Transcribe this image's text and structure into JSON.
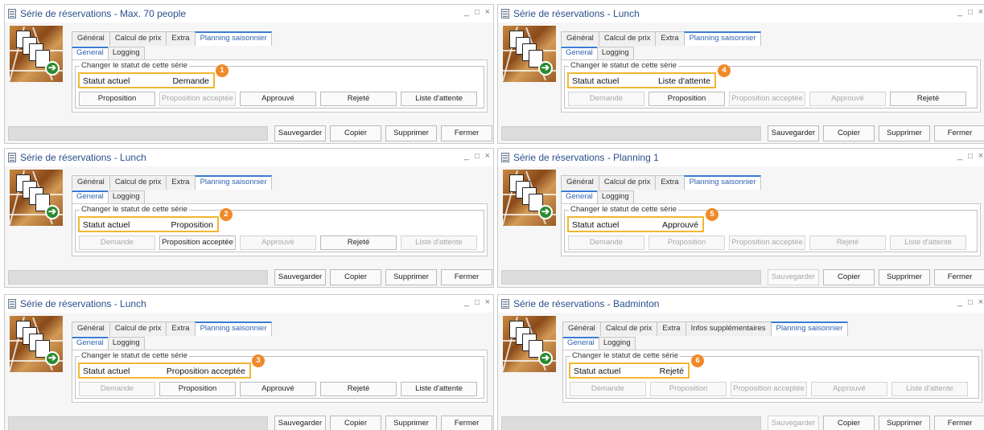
{
  "windows": [
    {
      "title": "Série de réservations - Max. 70 people",
      "tabs": [
        {
          "label": "Général",
          "active": false
        },
        {
          "label": "Calcul de prix",
          "active": false
        },
        {
          "label": "Extra",
          "active": false
        },
        {
          "label": "Planning saisonnier",
          "active": true
        }
      ],
      "subtabs": [
        {
          "label": "General",
          "active": true
        },
        {
          "label": "Logging",
          "active": false
        }
      ],
      "group_label": "Changer le statut de cette série",
      "status_label": "Statut actuel",
      "status_value": "Demande",
      "marker": "1",
      "status_buttons": [
        {
          "label": "Proposition",
          "enabled": true
        },
        {
          "label": "Proposition acceptée",
          "enabled": false
        },
        {
          "label": "Approuvé",
          "enabled": true
        },
        {
          "label": "Rejeté",
          "enabled": true
        },
        {
          "label": "Liste d'attente",
          "enabled": true
        }
      ],
      "action_buttons": [
        {
          "label": "Sauvegarder",
          "enabled": true
        },
        {
          "label": "Copier",
          "enabled": true
        },
        {
          "label": "Supprimer",
          "enabled": true
        },
        {
          "label": "Fermer",
          "enabled": true
        }
      ],
      "window_controls": [
        "_",
        "□",
        "×"
      ]
    },
    {
      "title": "Série de réservations - Lunch",
      "tabs": [
        {
          "label": "Général",
          "active": false
        },
        {
          "label": "Calcul de prix",
          "active": false
        },
        {
          "label": "Extra",
          "active": false
        },
        {
          "label": "Planning saisonnier",
          "active": true
        }
      ],
      "subtabs": [
        {
          "label": "General",
          "active": true
        },
        {
          "label": "Logging",
          "active": false
        }
      ],
      "group_label": "Changer le statut de cette série",
      "status_label": "Statut actuel",
      "status_value": "Liste d'attente",
      "marker": "4",
      "status_buttons": [
        {
          "label": "Demande",
          "enabled": false
        },
        {
          "label": "Proposition",
          "enabled": true
        },
        {
          "label": "Proposition acceptée",
          "enabled": false
        },
        {
          "label": "Approuvé",
          "enabled": false
        },
        {
          "label": "Rejeté",
          "enabled": true
        }
      ],
      "action_buttons": [
        {
          "label": "Sauvegarder",
          "enabled": true
        },
        {
          "label": "Copier",
          "enabled": true
        },
        {
          "label": "Supprimer",
          "enabled": true
        },
        {
          "label": "Fermer",
          "enabled": true
        }
      ],
      "window_controls": [
        "_",
        "□",
        "×"
      ]
    },
    {
      "title": "Série de réservations - Lunch",
      "tabs": [
        {
          "label": "Général",
          "active": false
        },
        {
          "label": "Calcul de prix",
          "active": false
        },
        {
          "label": "Extra",
          "active": false
        },
        {
          "label": "Planning saisonnier",
          "active": true
        }
      ],
      "subtabs": [
        {
          "label": "General",
          "active": true
        },
        {
          "label": "Logging",
          "active": false
        }
      ],
      "group_label": "Changer le statut de cette série",
      "status_label": "Statut actuel",
      "status_value": "Proposition",
      "marker": "2",
      "status_buttons": [
        {
          "label": "Demande",
          "enabled": false
        },
        {
          "label": "Proposition acceptée",
          "enabled": true
        },
        {
          "label": "Approuvé",
          "enabled": false
        },
        {
          "label": "Rejeté",
          "enabled": true
        },
        {
          "label": "Liste d'attente",
          "enabled": false
        }
      ],
      "action_buttons": [
        {
          "label": "Sauvegarder",
          "enabled": true
        },
        {
          "label": "Copier",
          "enabled": true
        },
        {
          "label": "Supprimer",
          "enabled": true
        },
        {
          "label": "Fermer",
          "enabled": true
        }
      ],
      "window_controls": [
        "_",
        "□",
        "×"
      ]
    },
    {
      "title": "Série de réservations - Planning 1",
      "tabs": [
        {
          "label": "Général",
          "active": false
        },
        {
          "label": "Calcul de prix",
          "active": false
        },
        {
          "label": "Extra",
          "active": false
        },
        {
          "label": "Planning saisonnier",
          "active": true
        }
      ],
      "subtabs": [
        {
          "label": "General",
          "active": true
        },
        {
          "label": "Logging",
          "active": false
        }
      ],
      "group_label": "Changer le statut de cette série",
      "status_label": "Statut actuel",
      "status_value": "Approuvé",
      "marker": "5",
      "status_buttons": [
        {
          "label": "Demande",
          "enabled": false
        },
        {
          "label": "Proposition",
          "enabled": false
        },
        {
          "label": "Proposition acceptée",
          "enabled": false
        },
        {
          "label": "Rejeté",
          "enabled": false
        },
        {
          "label": "Liste d'attente",
          "enabled": false
        }
      ],
      "action_buttons": [
        {
          "label": "Sauvegarder",
          "enabled": false
        },
        {
          "label": "Copier",
          "enabled": true
        },
        {
          "label": "Supprimer",
          "enabled": true
        },
        {
          "label": "Fermer",
          "enabled": true
        }
      ],
      "window_controls": [
        "_",
        "□",
        "×"
      ]
    },
    {
      "title": "Série de réservations - Lunch",
      "tabs": [
        {
          "label": "Général",
          "active": false
        },
        {
          "label": "Calcul de prix",
          "active": false
        },
        {
          "label": "Extra",
          "active": false
        },
        {
          "label": "Planning saisonnier",
          "active": true
        }
      ],
      "subtabs": [
        {
          "label": "General",
          "active": true
        },
        {
          "label": "Logging",
          "active": false
        }
      ],
      "group_label": "Changer le statut de cette série",
      "status_label": "Statut actuel",
      "status_value": "Proposition acceptée",
      "marker": "3",
      "status_buttons": [
        {
          "label": "Demande",
          "enabled": false
        },
        {
          "label": "Proposition",
          "enabled": true
        },
        {
          "label": "Approuvé",
          "enabled": true
        },
        {
          "label": "Rejeté",
          "enabled": true
        },
        {
          "label": "Liste d'attente",
          "enabled": true
        }
      ],
      "action_buttons": [
        {
          "label": "Sauvegarder",
          "enabled": true
        },
        {
          "label": "Copier",
          "enabled": true
        },
        {
          "label": "Supprimer",
          "enabled": true
        },
        {
          "label": "Fermer",
          "enabled": true
        }
      ],
      "window_controls": [
        "_",
        "□",
        "×"
      ]
    },
    {
      "title": "Série de réservations - Badminton",
      "tabs": [
        {
          "label": "Général",
          "active": false
        },
        {
          "label": "Calcul de prix",
          "active": false
        },
        {
          "label": "Extra",
          "active": false
        },
        {
          "label": "Infos supplémentaires",
          "active": false
        },
        {
          "label": "Planning saisonnier",
          "active": true
        }
      ],
      "subtabs": [
        {
          "label": "General",
          "active": true
        },
        {
          "label": "Logging",
          "active": false
        }
      ],
      "group_label": "Changer le statut de cette série",
      "status_label": "Statut actuel",
      "status_value": "Rejeté",
      "marker": "6",
      "status_buttons": [
        {
          "label": "Demande",
          "enabled": false
        },
        {
          "label": "Proposition",
          "enabled": false
        },
        {
          "label": "Proposition acceptée",
          "enabled": false
        },
        {
          "label": "Approuvé",
          "enabled": false
        },
        {
          "label": "Liste d'attente",
          "enabled": false
        }
      ],
      "action_buttons": [
        {
          "label": "Sauvegarder",
          "enabled": false
        },
        {
          "label": "Copier",
          "enabled": true
        },
        {
          "label": "Supprimer",
          "enabled": true
        },
        {
          "label": "Fermer",
          "enabled": true
        }
      ],
      "window_controls": [
        "_",
        "□",
        "×"
      ]
    }
  ],
  "colors": {
    "highlight_border": "#f2b632",
    "marker": "#ef8a2a",
    "active_tab": "#3a7bd5",
    "title": "#2a4f8a"
  }
}
